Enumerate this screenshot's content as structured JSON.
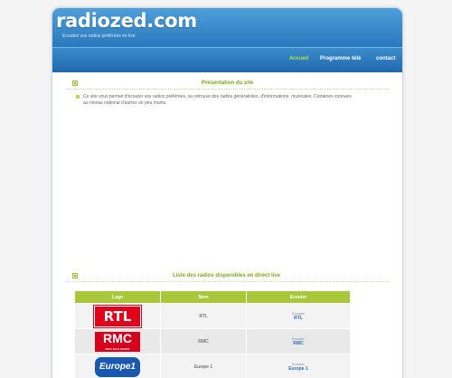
{
  "site": {
    "title": "radiozed.com",
    "tagline": "Ecoutez vos radios préférées en live"
  },
  "nav": {
    "items": [
      {
        "label": "Accueil",
        "active": true
      },
      {
        "label": "Programme télé",
        "active": false
      },
      {
        "label": "contact",
        "active": false
      }
    ]
  },
  "presentation": {
    "title": "Présentation du site",
    "text": "Ce site vous permet d'écouter vos radios préférées, sa retrouve des radios généralistes, d'informations, musicales. Certaines connues au niveau national d'autres un peu moins."
  },
  "radios": {
    "title": "Liste des radios disponibles en direct live",
    "columns": [
      "Logo",
      "Nom",
      "Ecouter"
    ],
    "rows": [
      {
        "logo": "RTL",
        "name": "RTL",
        "listen_label": "Ecouter",
        "listen_link": "RTL"
      },
      {
        "logo": "RMC",
        "logo_sub": "INFO TALK SPORT",
        "name": "RMC",
        "listen_label": "Ecouter",
        "listen_link": "RMC"
      },
      {
        "logo": "Europe1",
        "name": "Europe 1",
        "listen_label": "Ecouter",
        "listen_link": "Europe 1"
      }
    ]
  },
  "colors": {
    "header_blue": "#2a78bd",
    "accent_green": "#7ea81a",
    "table_header": "#a8c83a"
  }
}
